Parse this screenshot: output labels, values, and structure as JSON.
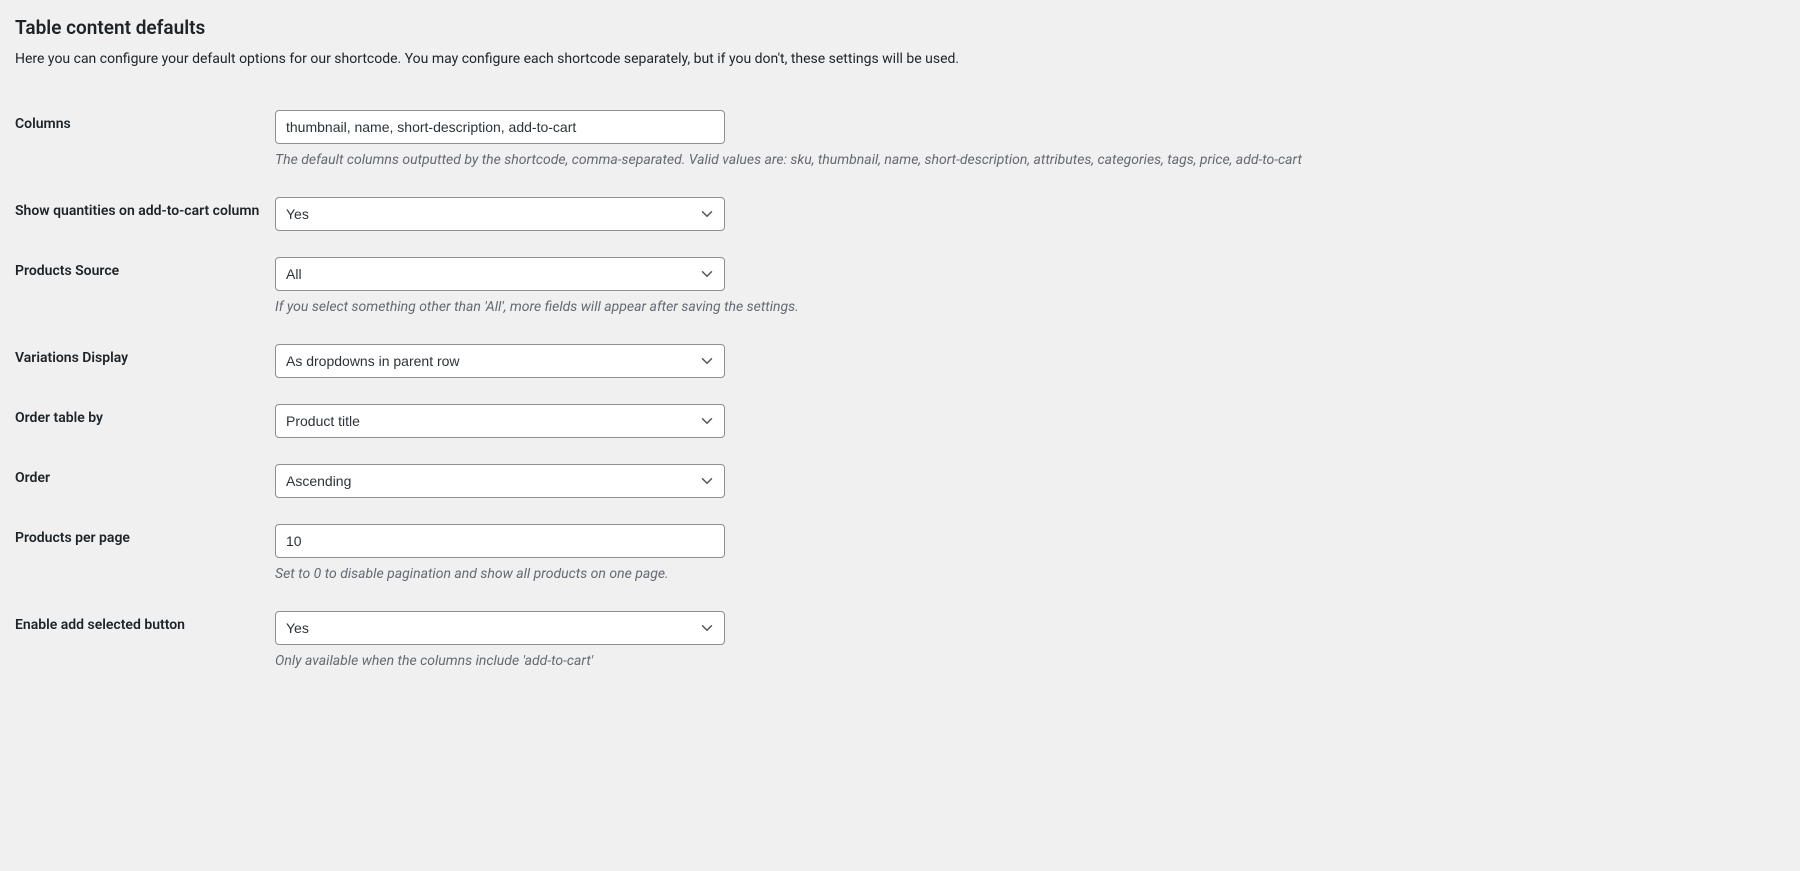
{
  "section": {
    "title": "Table content defaults",
    "description": "Here you can configure your default options for our shortcode. You may configure each shortcode separately, but if you don't, these settings will be used."
  },
  "fields": {
    "columns": {
      "label": "Columns",
      "value": "thumbnail, name, short-description, add-to-cart",
      "help": "The default columns outputted by the shortcode, comma-separated. Valid values are: sku, thumbnail, name, short-description, attributes, categories, tags, price, add-to-cart"
    },
    "show_quantities": {
      "label": "Show quantities on add-to-cart column",
      "value": "Yes"
    },
    "products_source": {
      "label": "Products Source",
      "value": "All",
      "help": "If you select something other than 'All', more fields will appear after saving the settings."
    },
    "variations_display": {
      "label": "Variations Display",
      "value": "As dropdowns in parent row"
    },
    "order_by": {
      "label": "Order table by",
      "value": "Product title"
    },
    "order": {
      "label": "Order",
      "value": "Ascending"
    },
    "products_per_page": {
      "label": "Products per page",
      "value": "10",
      "help": "Set to 0 to disable pagination and show all products on one page."
    },
    "enable_add_selected": {
      "label": "Enable add selected button",
      "value": "Yes",
      "help": "Only available when the columns include 'add-to-cart'"
    }
  }
}
